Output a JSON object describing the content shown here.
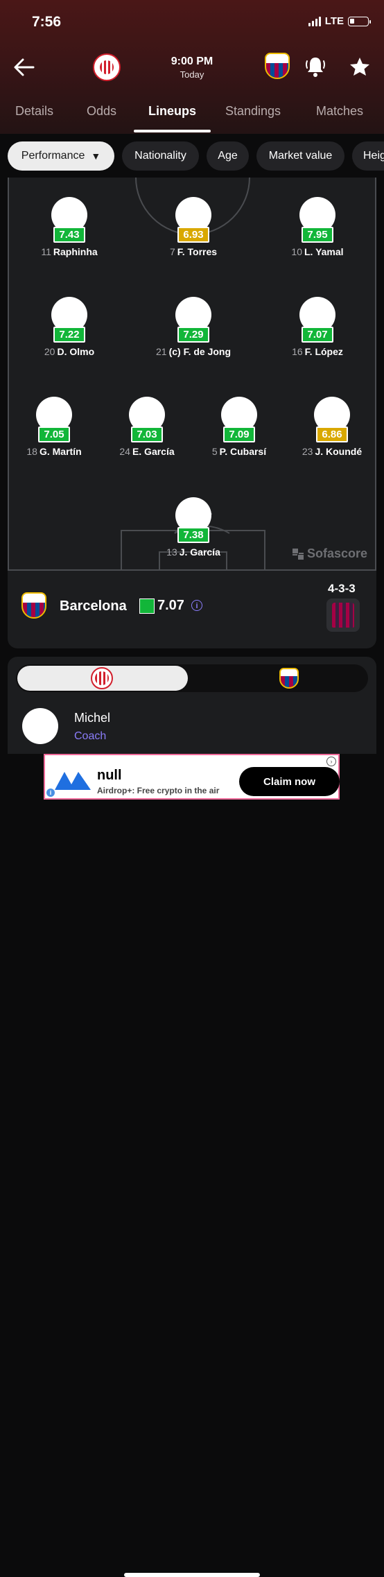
{
  "status_bar": {
    "time": "7:56",
    "network": "LTE"
  },
  "match": {
    "kickoff": "9:00 PM",
    "day": "Today"
  },
  "tabs": [
    {
      "label": "Details"
    },
    {
      "label": "Odds"
    },
    {
      "label": "Lineups",
      "active": true
    },
    {
      "label": "Standings"
    },
    {
      "label": "Matches"
    }
  ],
  "filters": [
    {
      "label": "Performance",
      "active": true
    },
    {
      "label": "Nationality"
    },
    {
      "label": "Age"
    },
    {
      "label": "Market value"
    },
    {
      "label": "Heig"
    }
  ],
  "colors": {
    "rating_green": "#12b639",
    "rating_yellow": "#d9a800",
    "accent": "#8b7dfa"
  },
  "lineup": {
    "forwards": [
      {
        "number": "11",
        "name": "Raphinha",
        "rating": "7.43",
        "rating_level": "green"
      },
      {
        "number": "7",
        "name": "F. Torres",
        "rating": "6.93",
        "rating_level": "yellow"
      },
      {
        "number": "10",
        "name": "L. Yamal",
        "rating": "7.95",
        "rating_level": "green"
      }
    ],
    "midfielders": [
      {
        "number": "20",
        "name": "D. Olmo",
        "rating": "7.22",
        "rating_level": "green"
      },
      {
        "number": "21",
        "name": "(c) F. de Jong",
        "rating": "7.29",
        "rating_level": "green"
      },
      {
        "number": "16",
        "name": "F. López",
        "rating": "7.07",
        "rating_level": "green"
      }
    ],
    "defenders": [
      {
        "number": "18",
        "name": "G. Martín",
        "rating": "7.05",
        "rating_level": "green"
      },
      {
        "number": "24",
        "name": "E. García",
        "rating": "7.03",
        "rating_level": "green"
      },
      {
        "number": "5",
        "name": "P. Cubarsí",
        "rating": "7.09",
        "rating_level": "green"
      },
      {
        "number": "23",
        "name": "J. Koundé",
        "rating": "6.86",
        "rating_level": "yellow"
      }
    ],
    "goalkeeper": [
      {
        "number": "13",
        "name": "J. García",
        "rating": "7.38",
        "rating_level": "green"
      }
    ],
    "watermark": "Sofascore"
  },
  "team": {
    "name": "Barcelona",
    "rating": "7.07",
    "formation": "4-3-3"
  },
  "coach": {
    "name": "Michel",
    "role": "Coach"
  },
  "ad": {
    "title": "null",
    "subtitle": "Airdrop+: Free crypto in the air",
    "button": "Claim now"
  }
}
